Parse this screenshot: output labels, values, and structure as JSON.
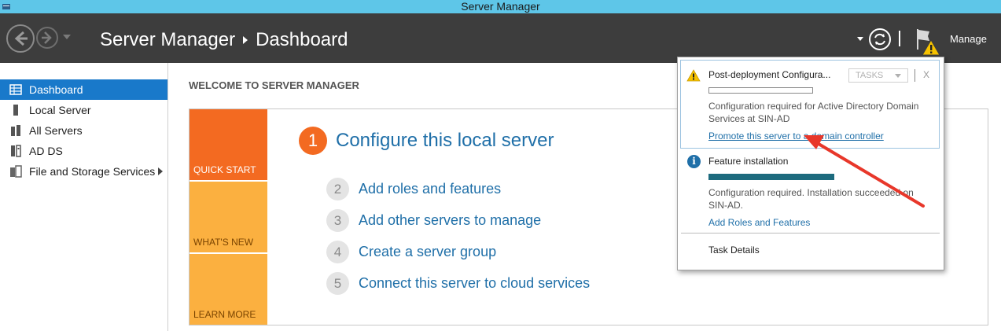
{
  "window": {
    "title": "Server Manager"
  },
  "header": {
    "breadcrumb_root": "Server Manager",
    "breadcrumb_page": "Dashboard",
    "manage_label": "Manage"
  },
  "sidebar": {
    "items": [
      {
        "label": "Dashboard",
        "icon": "dashboard-grid-icon",
        "active": true
      },
      {
        "label": "Local Server",
        "icon": "server-icon"
      },
      {
        "label": "All Servers",
        "icon": "servers-icon"
      },
      {
        "label": "AD DS",
        "icon": "ad-ds-icon"
      },
      {
        "label": "File and Storage Services",
        "icon": "storage-icon",
        "has_submenu": true
      }
    ]
  },
  "main": {
    "welcome_heading": "WELCOME TO SERVER MANAGER",
    "tiles": {
      "quick_start": "QUICK START",
      "whats_new": "WHAT'S NEW",
      "learn_more": "LEARN MORE"
    },
    "steps": [
      {
        "num": "1",
        "label": "Configure this local server"
      },
      {
        "num": "2",
        "label": "Add roles and features"
      },
      {
        "num": "3",
        "label": "Add other servers to manage"
      },
      {
        "num": "4",
        "label": "Create a server group"
      },
      {
        "num": "5",
        "label": "Connect this server to cloud services"
      }
    ]
  },
  "notifications": {
    "item1": {
      "title": "Post-deployment Configura...",
      "tasks_label": "TASKS",
      "close_label": "X",
      "progress": 0,
      "description": "Configuration required for Active Directory Domain Services at SIN-AD",
      "link": "Promote this server to a domain controller"
    },
    "item2": {
      "title": "Feature installation",
      "progress": 1.0,
      "description": "Configuration required. Installation succeeded on SIN-AD.",
      "link": "Add Roles and Features"
    },
    "task_details": "Task Details"
  },
  "colors": {
    "titlebar": "#5ec6e8",
    "header": "#3d3d3d",
    "accent_blue": "#1979ca",
    "quick_start_orange": "#f36a21",
    "tile_amber": "#fbb040",
    "link_blue": "#1f6fa8",
    "annotation_red": "#e8372a"
  }
}
